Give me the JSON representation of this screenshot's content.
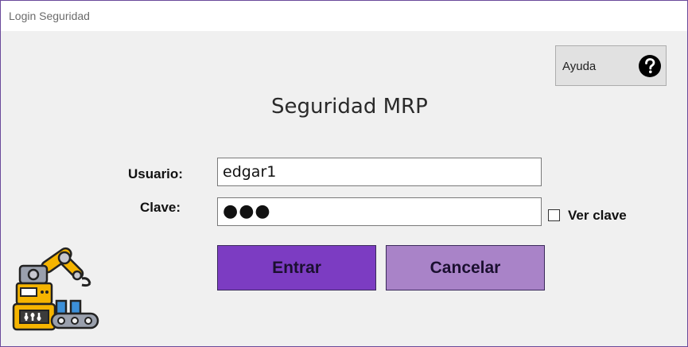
{
  "window": {
    "title": "Login Seguridad"
  },
  "help": {
    "label": "Ayuda",
    "icon": "question-circle-icon"
  },
  "heading": "Seguridad MRP",
  "form": {
    "user_label": "Usuario:",
    "user_value": "edgar1",
    "pass_label": "Clave:",
    "pass_value": "●●●",
    "show_pass_label": "Ver clave",
    "show_pass_checked": false
  },
  "buttons": {
    "enter": "Entrar",
    "cancel": "Cancelar"
  },
  "colors": {
    "accent": "#7c3cc2",
    "secondary": "#a983c8",
    "background": "#f0f0f0"
  },
  "logo": {
    "icon": "industrial-robot-arm-icon"
  }
}
